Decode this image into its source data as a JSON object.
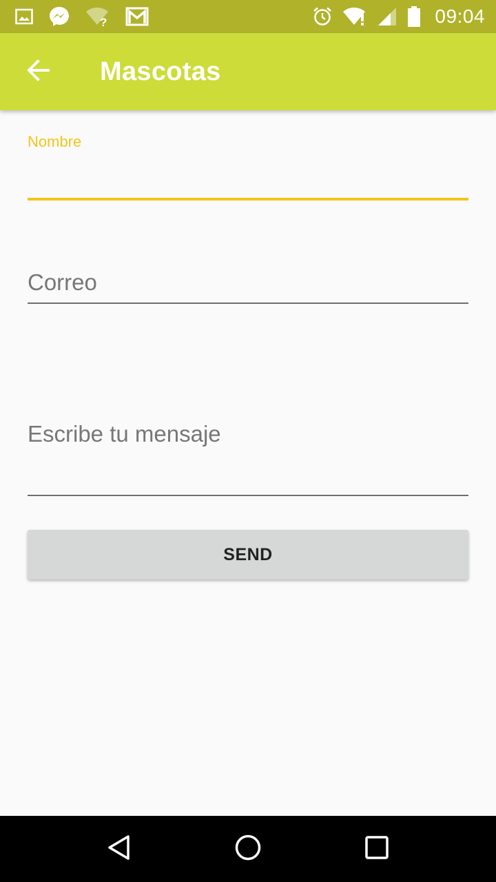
{
  "status_bar": {
    "time": "09:04",
    "left_icons": [
      "image-icon",
      "messenger-icon",
      "wifi-question-icon",
      "gmail-icon"
    ],
    "right_icons": [
      "alarm-icon",
      "wifi-alert-icon",
      "cell-signal-icon",
      "battery-icon"
    ]
  },
  "app_bar": {
    "title": "Mascotas",
    "back_icon": "arrow-back-icon",
    "background_color": "#cddc39"
  },
  "form": {
    "nombre": {
      "label": "Nombre",
      "value": ""
    },
    "correo": {
      "placeholder": "Correo",
      "value": ""
    },
    "mensaje": {
      "placeholder": "Escribe tu mensaje",
      "value": ""
    },
    "send_label": "SEND",
    "accent_color": "#f5c518"
  },
  "nav_bar": {
    "items": [
      "back-triangle-icon",
      "home-circle-icon",
      "recents-square-icon"
    ]
  }
}
